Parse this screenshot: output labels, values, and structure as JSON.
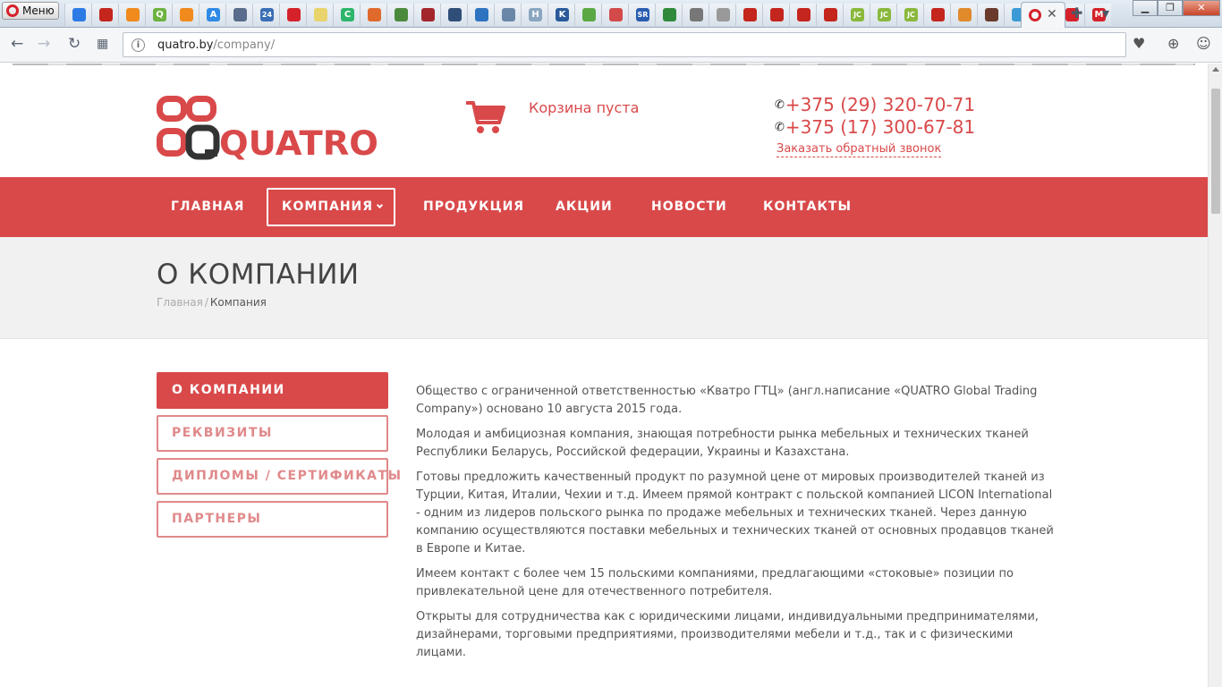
{
  "browser": {
    "menu_label": "Меню",
    "pinned_tabs": [
      {
        "icon": "mail-icon",
        "color": "#2c7be5",
        "glyph": ""
      },
      {
        "icon": "speedometer-icon",
        "color": "#c4251c",
        "glyph": ""
      },
      {
        "icon": "trend-icon",
        "color": "#f08a1c",
        "glyph": ""
      },
      {
        "icon": "q-icon",
        "color": "#6cb33f",
        "glyph": "Q"
      },
      {
        "icon": "trend-icon",
        "color": "#f08a1c",
        "glyph": ""
      },
      {
        "icon": "ads-icon",
        "color": "#2e8ae6",
        "glyph": "A"
      },
      {
        "icon": "doc-icon",
        "color": "#5a6c8c",
        "glyph": ""
      },
      {
        "icon": "24-icon",
        "color": "#3a6fb5",
        "glyph": "24"
      },
      {
        "icon": "opera-icon",
        "color": "#d5222a",
        "glyph": ""
      },
      {
        "icon": "line-icon",
        "color": "#e9d36b",
        "glyph": ""
      },
      {
        "icon": "c-icon",
        "color": "#2db56b",
        "glyph": "C"
      },
      {
        "icon": "flame-icon",
        "color": "#e06a2c",
        "glyph": ""
      },
      {
        "icon": "drop-icon",
        "color": "#4b8a3c",
        "glyph": ""
      },
      {
        "icon": "hash-icon",
        "color": "#a3262c",
        "glyph": ""
      },
      {
        "icon": "layers-icon",
        "color": "#2f4f78",
        "glyph": ""
      },
      {
        "icon": "list-icon",
        "color": "#2d73c0",
        "glyph": ""
      },
      {
        "icon": "gear-icon",
        "color": "#6a87a8",
        "glyph": ""
      },
      {
        "icon": "h-icon",
        "color": "#8aa6c0",
        "glyph": "H"
      },
      {
        "icon": "k-icon",
        "color": "#2a5a9b",
        "glyph": "K"
      },
      {
        "icon": "tripadvisor-icon",
        "color": "#5aa844",
        "glyph": ""
      },
      {
        "icon": "chart-icon",
        "color": "#d34a4a",
        "glyph": ""
      },
      {
        "icon": "sr-icon",
        "color": "#2a5db0",
        "glyph": "SR"
      },
      {
        "icon": "sheet-icon",
        "color": "#2f8a3c",
        "glyph": ""
      },
      {
        "icon": "drive-icon",
        "color": "#777777",
        "glyph": ""
      },
      {
        "icon": "page-icon",
        "color": "#999999",
        "glyph": ""
      },
      {
        "icon": "badge-icon",
        "color": "#c4251c",
        "glyph": ""
      },
      {
        "icon": "badge-icon",
        "color": "#c4251c",
        "glyph": ""
      },
      {
        "icon": "badge-icon",
        "color": "#c4251c",
        "glyph": ""
      },
      {
        "icon": "badge-icon",
        "color": "#c4251c",
        "glyph": ""
      },
      {
        "icon": "jc-icon",
        "color": "#8ab83c",
        "glyph": "JC"
      },
      {
        "icon": "jc-icon",
        "color": "#8ab83c",
        "glyph": "JC"
      },
      {
        "icon": "jc-icon",
        "color": "#8ab83c",
        "glyph": "JC"
      },
      {
        "icon": "badge-icon",
        "color": "#c4251c",
        "glyph": ""
      },
      {
        "icon": "leaf-icon",
        "color": "#e08a2c",
        "glyph": ""
      },
      {
        "icon": "bug-icon",
        "color": "#6a3a2c",
        "glyph": ""
      },
      {
        "icon": "image-icon",
        "color": "#3a9ad6",
        "glyph": ""
      },
      {
        "icon": "plane-icon",
        "color": "#5aa0d6",
        "glyph": ""
      },
      {
        "icon": "opera-icon",
        "color": "#d5222a",
        "glyph": ""
      },
      {
        "icon": "gmail-icon",
        "color": "#d5222a",
        "glyph": "M"
      }
    ],
    "address": {
      "domain": "quatro.by",
      "path": "/company/"
    }
  },
  "header": {
    "logo_text": "QUATRO",
    "cart_label": "Корзина пуста",
    "phones": [
      "+375 (29) 320-70-71",
      "+375 (17) 300-67-81"
    ],
    "callback_label": "Заказать обратный звонок"
  },
  "nav": {
    "items": [
      "ГЛАВНАЯ",
      "КОМПАНИЯ",
      "ПРОДУКЦИЯ",
      "АКЦИИ",
      "НОВОСТИ",
      "КОНТАКТЫ"
    ],
    "active_index": 1
  },
  "page": {
    "title": "О КОМПАНИИ",
    "breadcrumb": {
      "home": "Главная",
      "separator": "/",
      "current": "Компания"
    }
  },
  "sidebar": {
    "items": [
      "О КОМПАНИИ",
      "РЕКВИЗИТЫ",
      "ДИПЛОМЫ / СЕРТИФИКАТЫ",
      "ПАРТНЕРЫ"
    ],
    "active_index": 0
  },
  "content": {
    "paragraphs": [
      "Общество с ограниченной ответственностью «Кватро ГТЦ» (англ.написание «QUATRO Global Trading Company») основано 10 августа 2015 года.",
      "Молодая и амбициозная компания, знающая потребности рынка мебельных и технических тканей Республики Беларусь, Российской федерации, Украины и Казахстана.",
      "Готовы предложить качественный продукт по разумной цене от мировых производителей тканей из Турции, Китая, Италии, Чехии и т.д. Имеем прямой контракт с польской компанией LICON International - одним из лидеров польского рынка по продаже мебельных и технических тканей. Через данную компанию осуществляются поставки мебельных и технических тканей от основных продавцов тканей в Европе и Китае.",
      "Имеем контакт с более чем 15 польскими компаниями, предлагающими «стоковые» позиции по привлекательной цене для отечественного потребителя.",
      "Открыты для сотрудничества как с юридическими лицами, индивидуальными предпринимателями, дизайнерами, торговыми предприятиями, производителями мебели и т.д., так и с физическими лицами."
    ]
  },
  "colors": {
    "brand": "#d9494a",
    "brand_light": "#e0898a",
    "title_band": "#f1f1f1"
  }
}
